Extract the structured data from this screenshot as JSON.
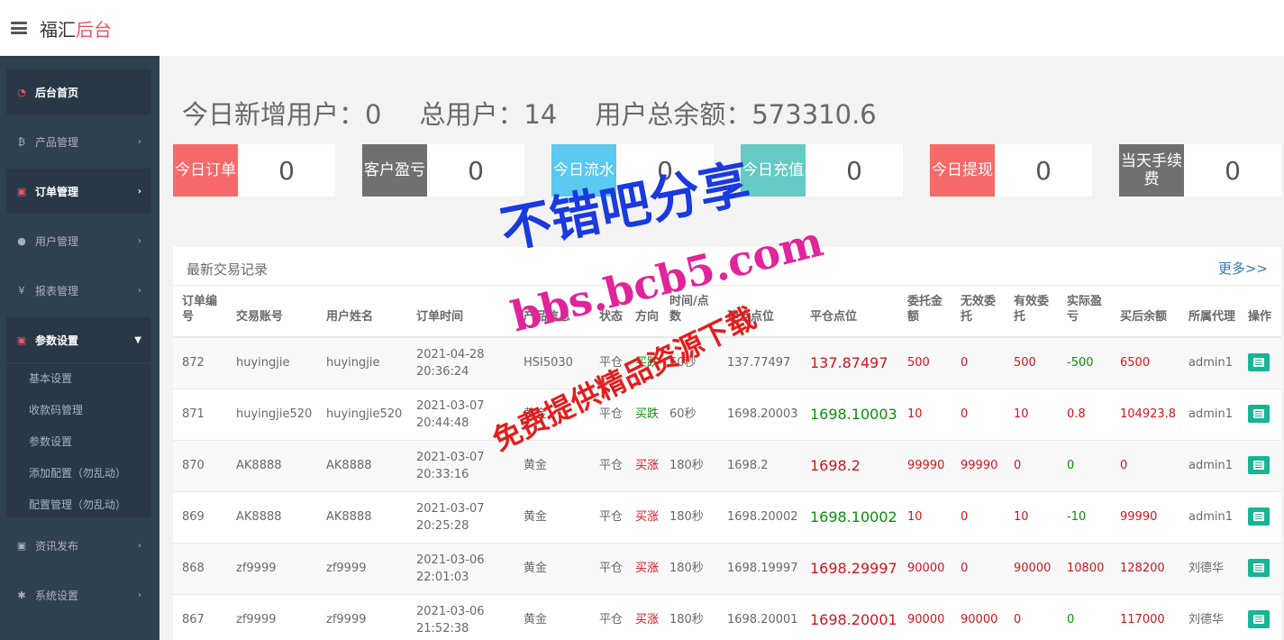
{
  "topbar": {
    "brand_main": "福汇",
    "brand_accent": "后台"
  },
  "sidebar": {
    "items": [
      {
        "label": "后台首页",
        "icon": "dashboard-icon"
      },
      {
        "label": "产品管理",
        "icon": "bitcoin-icon"
      },
      {
        "label": "订单管理",
        "icon": "copy-icon"
      },
      {
        "label": "用户管理",
        "icon": "user-icon"
      },
      {
        "label": "报表管理",
        "icon": "yen-icon"
      },
      {
        "label": "参数设置",
        "icon": "copy-icon"
      },
      {
        "label": "资讯发布",
        "icon": "copy-icon"
      },
      {
        "label": "系统设置",
        "icon": "gears-icon"
      }
    ],
    "sub_items": [
      "基本设置",
      "收款码管理",
      "参数设置",
      "添加配置（勿乱动）",
      "配置管理（勿乱动）"
    ]
  },
  "headline": {
    "new_users": "今日新增用户：0",
    "total_users": "总用户：14",
    "total_balance": "用户总余额：573310.6"
  },
  "stats": [
    {
      "label": "今日订单",
      "value": "0",
      "color": "#f8696a"
    },
    {
      "label": "客户盈亏",
      "value": "0",
      "color": "#707070"
    },
    {
      "label": "今日流水",
      "value": "0",
      "color": "#5ac8ef"
    },
    {
      "label": "今日充值",
      "value": "0",
      "color": "#65cac4"
    },
    {
      "label": "今日提现",
      "value": "0",
      "color": "#f8696a"
    },
    {
      "label": "当天手续费",
      "value": "0",
      "color": "#707070"
    }
  ],
  "panel": {
    "title": "最新交易记录",
    "more": "更多>>"
  },
  "table": {
    "headers": [
      "订单编号",
      "交易账号",
      "用户姓名",
      "订单时间",
      "产品信息",
      "状态",
      "方向",
      "时间/点数",
      "建仓点位",
      "平仓点位",
      "委托金额",
      "无效委托",
      "有效委托",
      "实际盈亏",
      "买后余额",
      "所属代理",
      "操作"
    ],
    "rows": [
      [
        "872",
        "huyingjie",
        "huyingjie",
        "2021-04-28 20:36:24",
        "HSI5030",
        "平仓",
        "买跌",
        "60秒",
        "137.77497",
        "137.87497",
        "500",
        "0",
        "500",
        "-500",
        "6500",
        "admin1"
      ],
      [
        "871",
        "huyingjie520",
        "huyingjie520",
        "2021-03-07 20:44:48",
        "黄金",
        "平仓",
        "买跌",
        "60秒",
        "1698.20003",
        "1698.10003",
        "10",
        "0",
        "10",
        "0.8",
        "104923.8",
        "admin1"
      ],
      [
        "870",
        "AK8888",
        "AK8888",
        "2021-03-07 20:33:16",
        "黄金",
        "平仓",
        "买涨",
        "180秒",
        "1698.2",
        "1698.2",
        "99990",
        "99990",
        "0",
        "0",
        "0",
        "admin1"
      ],
      [
        "869",
        "AK8888",
        "AK8888",
        "2021-03-07 20:25:28",
        "黄金",
        "平仓",
        "买涨",
        "180秒",
        "1698.20002",
        "1698.10002",
        "10",
        "0",
        "10",
        "-10",
        "99990",
        "admin1"
      ],
      [
        "868",
        "zf9999",
        "zf9999",
        "2021-03-06 22:01:03",
        "黄金",
        "平仓",
        "买涨",
        "180秒",
        "1698.19997",
        "1698.29997",
        "90000",
        "0",
        "90000",
        "10800",
        "128200",
        "刘德华"
      ],
      [
        "867",
        "zf9999",
        "zf9999",
        "2021-03-06 21:52:38",
        "黄金",
        "平仓",
        "买涨",
        "180秒",
        "1698.20001",
        "1698.20001",
        "90000",
        "90000",
        "0",
        "0",
        "117000",
        "刘德华"
      ]
    ]
  },
  "watermark": {
    "line1": "不错吧分享",
    "line2": "bbs.bcb5.com",
    "line3": "免费提供精品资源下载"
  },
  "colors": {
    "sidebar": "#2f4050",
    "profit": "#d3141e",
    "loss": "#0e8c0e",
    "action": "#1ab394"
  }
}
